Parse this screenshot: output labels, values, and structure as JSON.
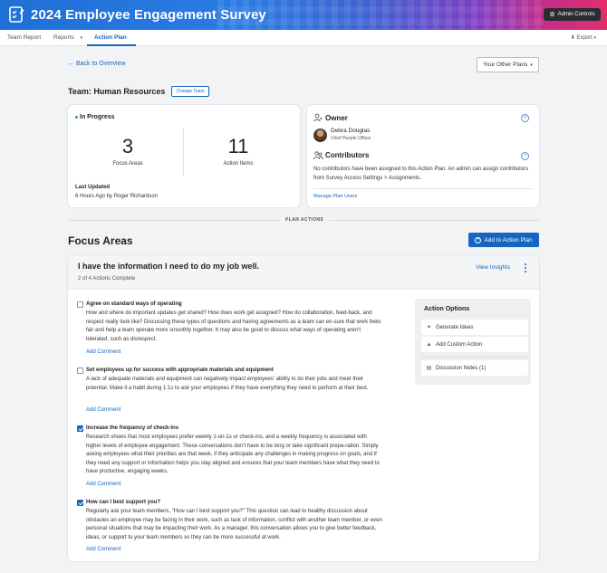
{
  "header": {
    "title": "2024 Employee Engagement Survey",
    "admin_label": "Admin Controls",
    "admin_icon": "gear-icon",
    "logo_icon": "survey-logo-icon",
    "colors": {
      "gradient_start": "#1f6fd6",
      "gradient_end": "#e0306a",
      "admin_bg": "#2b2b33"
    }
  },
  "nav": {
    "items": [
      {
        "label": "Team Report"
      },
      {
        "label": "Reports"
      },
      {
        "label": "Action Plan",
        "active": true
      }
    ],
    "reports_caret": "▾",
    "export_label": "Export",
    "export_caret": "▾",
    "accent": "#1566c0"
  },
  "top": {
    "back_label": "Back to Overview",
    "other_plans_label": "Your Other Plans",
    "other_plans_caret": "▾",
    "team_label": "Team: Human Resources",
    "change_team_label": "Change Team"
  },
  "progress": {
    "status": "In Progress",
    "status_color": "#2aa36b",
    "focus_areas_count": "3",
    "focus_areas_label": "Focus Areas",
    "action_items_count": "11",
    "action_items_label": "Action Items",
    "last_updated_label": "Last Updated",
    "last_updated_value": "6 Hours Ago by Roger Richardson"
  },
  "owner": {
    "title": "Owner",
    "name": "Debra Douglas",
    "role": "Chief People Officer",
    "help_glyph": "?",
    "contributors_title": "Contributors",
    "contributors_text": "No contributors have been assigned to this Action Plan. An admin can assign contributors from Survey Access Settings > Assignments.",
    "manage_users_label": "Manage Plan Users"
  },
  "plan_actions_label": "PLAN ACTIONS",
  "focus": {
    "title": "Focus Areas",
    "add_button_label": "Add to Action Plan",
    "add_button_glyph": "+",
    "question": "I have the information I need to do my job well.",
    "subtext": "2 of 4 Actions Complete",
    "view_insights_label": "View Insights",
    "actions": [
      {
        "title": "Agree on standard ways of operating",
        "checked": false,
        "description": "How and where do important updates get shared? How does work get assigned? How do collaboration, feed-back, and respect really look like? Discussing these types of questions and having agreements as a team can en-sure that work feels fair and help a team operate more smoothly together. It may also be good to discuss what ways of operating aren't tolerated, such as disrespect.",
        "comment_label": "Add Comment"
      },
      {
        "title": "Set employees up for success with appropriate materials and equipment",
        "checked": false,
        "description": "A lack of adequate materials and equipment can negatively impact employees' ability to do their jobs and meet their potential. Make it a habit during 1:1s to ask your employees if they have everything they need to perform at their best.",
        "comment_label": "Add Comment"
      },
      {
        "title": "Increase the frequency of check-ins",
        "checked": true,
        "description": "Research shows that most employees prefer weekly 1-on-1s or check-ins, and a weekly frequency is associated with higher levels of employee engagement. These conversations don't have to be long or take significant prepa-ration. Simply asking employees what their priorities are that week, if they anticipate any challenges in making progress on goals, and if they need any support or information helps you stay aligned and ensures that your team members have what they need to have productive, engaging weeks.",
        "comment_label": "Add Comment"
      },
      {
        "title": "How can I best support you?",
        "checked": true,
        "description": "Regularly ask your team members, \"How can I best support you?\" This question can lead to healthy discussion about obstacles an employee may be facing in their work, such as lack of information, conflict with another team member, or even personal situations that may be impacting their work. As a manager, this conversation allows you to give better feedback, ideas, or support to your team members so they can be more successful at work.",
        "comment_label": "Add Comment"
      }
    ],
    "options": {
      "title": "Action Options",
      "generate_ideas_label": "Generate Ideas",
      "generate_ideas_icon": "sparkle-icon",
      "add_custom_label": "Add Custom Action",
      "add_custom_icon": "flask-icon",
      "discussion_label": "Discussion Notes (1)",
      "discussion_icon": "notes-icon"
    }
  }
}
